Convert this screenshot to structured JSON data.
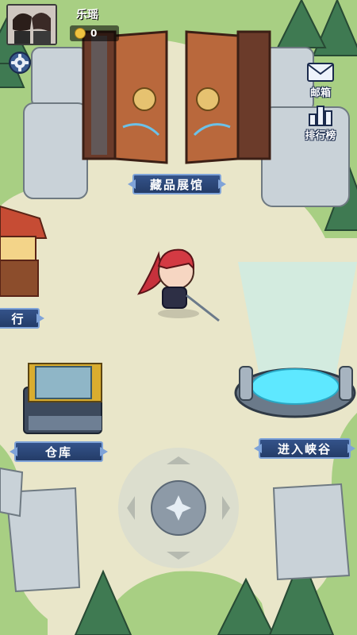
{
  "player": {
    "name": "乐瑶",
    "coins": "0"
  },
  "side_buttons": {
    "mail_label": "邮箱",
    "ranking_label": "排行榜"
  },
  "locations": {
    "museum": "藏品展馆",
    "left_shop": "行",
    "warehouse": "仓库",
    "enter_valley": "进入峡谷"
  },
  "icons": [
    "gear-icon",
    "mail-icon",
    "ranking-icon",
    "coin-icon",
    "joystick-icon"
  ],
  "colors": {
    "plaque": "#2f4c80",
    "plaque_border": "#7fa3d8",
    "ground": "#e9e6c9",
    "portal": "#5ee8ff"
  }
}
